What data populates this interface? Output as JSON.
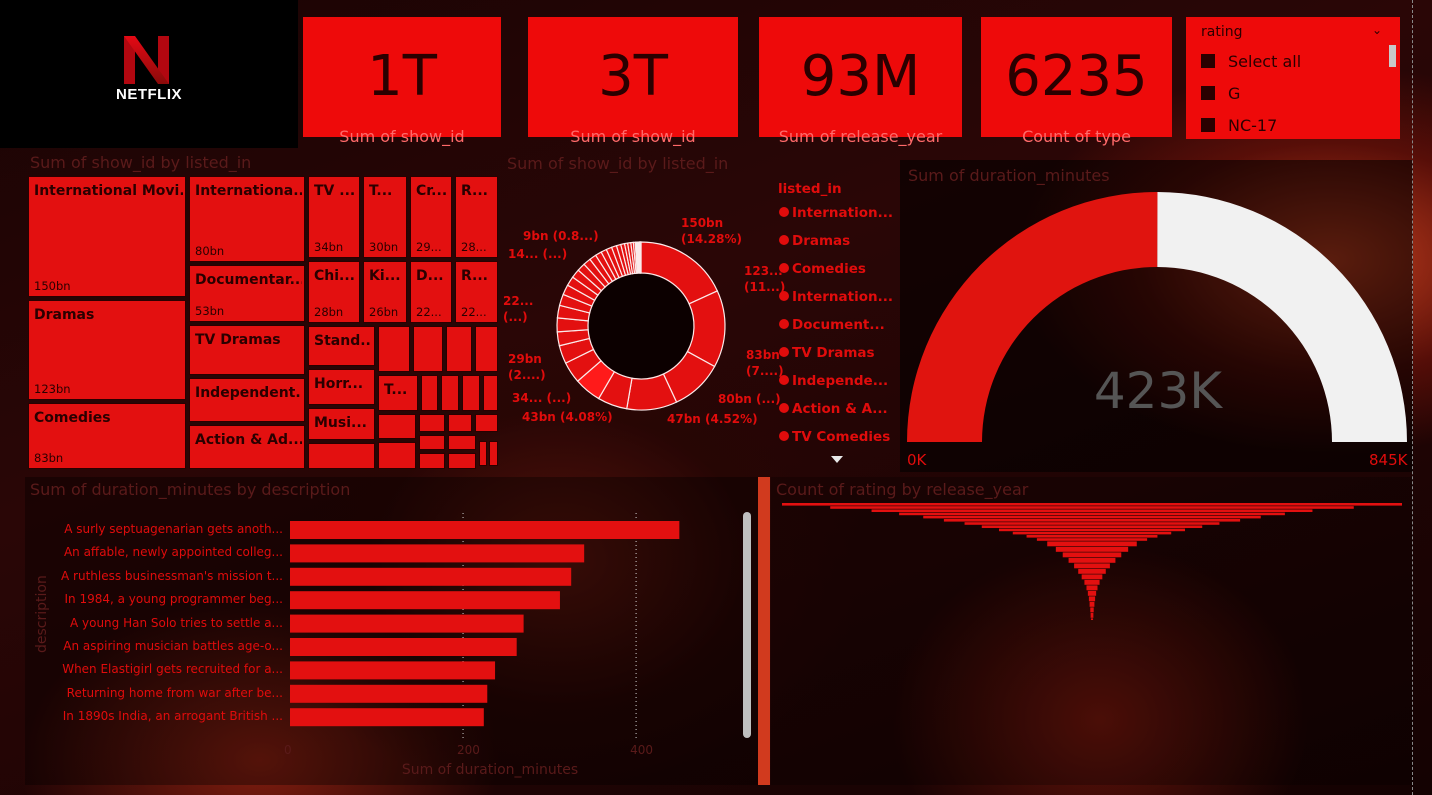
{
  "logo": {
    "brand": "NETFLIX",
    "icon": "netflix-n-logo-icon"
  },
  "kpis": [
    {
      "value": "1T",
      "label": "Sum of show_id"
    },
    {
      "value": "3T",
      "label": "Sum of show_id"
    },
    {
      "value": "93M",
      "label": "Sum of release_year"
    },
    {
      "value": "6235",
      "label": "Count of type"
    }
  ],
  "slicer": {
    "title": "rating",
    "options": [
      "Select all",
      "G",
      "NC-17"
    ]
  },
  "colors": {
    "accent": "#e31010",
    "dark": "#2a0000",
    "panel_title": "#5a1a1a",
    "gauge_rest": "#f1f1f1"
  },
  "treemap": {
    "title": "Sum of show_id by listed_in",
    "tiles": [
      {
        "name": "International Movi...",
        "value": "150bn"
      },
      {
        "name": "Dramas",
        "value": "123bn"
      },
      {
        "name": "Comedies",
        "value": "83bn"
      },
      {
        "name": "Internationa...",
        "value": "80bn"
      },
      {
        "name": "Documentar...",
        "value": "53bn"
      },
      {
        "name": "TV Dramas",
        "value": ""
      },
      {
        "name": "Independent...",
        "value": ""
      },
      {
        "name": "Action & Ad...",
        "value": ""
      },
      {
        "name": "TV ...",
        "value": "34bn"
      },
      {
        "name": "T...",
        "value": "30bn"
      },
      {
        "name": "Cr...",
        "value": "29..."
      },
      {
        "name": "R...",
        "value": "28..."
      },
      {
        "name": "Chi...",
        "value": "28bn"
      },
      {
        "name": "Ki...",
        "value": "26bn"
      },
      {
        "name": "D...",
        "value": "22..."
      },
      {
        "name": "R...",
        "value": "22..."
      },
      {
        "name": "Stand...",
        "value": ""
      },
      {
        "name": "Horr...",
        "value": ""
      },
      {
        "name": "Musi...",
        "value": ""
      },
      {
        "name": "T...",
        "value": ""
      }
    ]
  },
  "donut": {
    "title": "Sum of show_id by listed_in",
    "legend_title": "listed_in",
    "legend": [
      "Internation...",
      "Dramas",
      "Comedies",
      "Internation...",
      "Document...",
      "TV Dramas",
      "Independe...",
      "Action & A...",
      "TV Comedies"
    ],
    "labels": [
      {
        "text": "150bn",
        "text2": "(14.28%)"
      },
      {
        "text": "123...",
        "text2": "(11...)"
      },
      {
        "text": "83bn",
        "text2": "(7....)"
      },
      {
        "text": "80bn (...)",
        "text2": ""
      },
      {
        "text": "47bn (4.52%)",
        "text2": ""
      },
      {
        "text": "43bn (4.08%)",
        "text2": ""
      },
      {
        "text": "34... (...)",
        "text2": ""
      },
      {
        "text": "29bn",
        "text2": "(2....)"
      },
      {
        "text": "22...",
        "text2": "(...)"
      },
      {
        "text": "14... (...)",
        "text2": ""
      },
      {
        "text": "9bn (0.8...)",
        "text2": ""
      }
    ]
  },
  "gauge": {
    "title": "Sum of duration_minutes",
    "value": "423K",
    "min": "0K",
    "max": "845K",
    "fraction": 0.5006
  },
  "chart_data": [
    {
      "type": "bar",
      "title": "Sum of duration_minutes by description",
      "xlabel": "Sum of duration_minutes",
      "ylabel": "description",
      "categories": [
        "A surly septuagenarian gets anoth...",
        "An affable, newly appointed colleg...",
        "A ruthless businessman's mission t...",
        "In 1984, a young programmer beg...",
        "A young Han Solo tries to settle a...",
        "An aspiring musician battles age-o...",
        "When Elastigirl gets recruited for a...",
        "Returning home from war after be...",
        "In 1890s India, an arrogant British ..."
      ],
      "values": [
        450,
        340,
        325,
        312,
        270,
        262,
        237,
        228,
        224
      ],
      "xlim": [
        0,
        460
      ],
      "xticks": [
        "0",
        "200",
        "400"
      ],
      "grid": true
    },
    {
      "type": "bar",
      "title": "Count of rating by release_year",
      "values": [
        900,
        760,
        640,
        560,
        490,
        430,
        370,
        320,
        270,
        230,
        190,
        160,
        130,
        105,
        85,
        68,
        52,
        40,
        30,
        22,
        16,
        12,
        9,
        7,
        5,
        4,
        3,
        2,
        2,
        1,
        1,
        1
      ]
    }
  ]
}
